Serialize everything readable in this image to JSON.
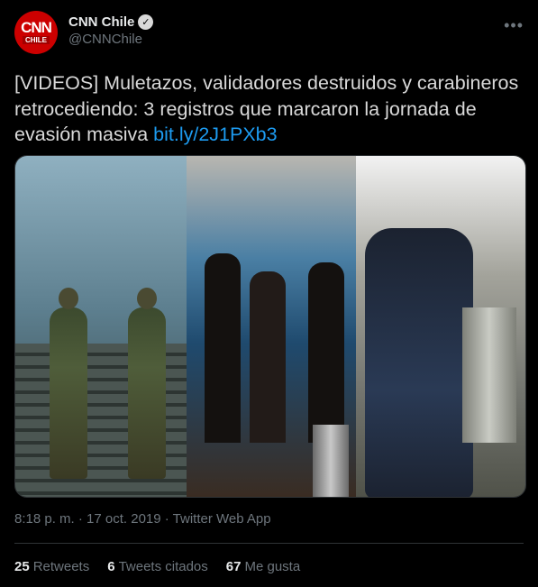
{
  "account": {
    "display_name": "CNN Chile",
    "handle": "@CNNChile",
    "avatar_logo_top": "CNN",
    "avatar_logo_bottom": "CHILE",
    "verified": true
  },
  "tweet": {
    "text": "[VIDEOS] Muletazos, validadores destruidos y carabineros retrocediendo: 3 registros que marcaron la jornada de evasión masiva ",
    "link_text": "bit.ly/2J1PXb3"
  },
  "media": {
    "panels": [
      "police-officers-at-stairs",
      "crowd-in-metro-station",
      "person-kicking-turnstile"
    ]
  },
  "meta": {
    "timestamp": "8:18 p. m. · 17 oct. 2019 · Twitter Web App"
  },
  "stats": {
    "retweets_count": "25",
    "retweets_label": "Retweets",
    "quotes_count": "6",
    "quotes_label": "Tweets citados",
    "likes_count": "67",
    "likes_label": "Me gusta"
  },
  "colors": {
    "background": "#000000",
    "link": "#1d9bf0",
    "secondary_text": "#6e767d",
    "brand_red": "#cc0000"
  }
}
